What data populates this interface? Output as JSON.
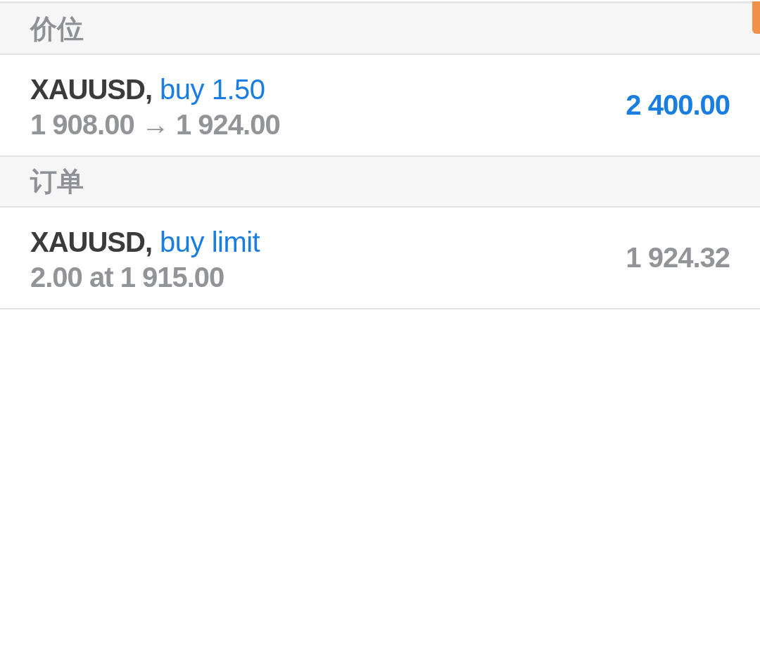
{
  "sections": [
    {
      "kind": "positions",
      "title": "价位",
      "items": [
        {
          "symbol": "XAUUSD,",
          "order_type": "buy 1.50",
          "details": "1 908.00 → 1 924.00",
          "value": "2 400.00"
        }
      ]
    },
    {
      "kind": "orders",
      "title": "订单",
      "items": [
        {
          "symbol": "XAUUSD,",
          "order_type": "buy limit",
          "details": "2.00 at 1 915.00",
          "value": "1 924.32"
        }
      ]
    }
  ]
}
